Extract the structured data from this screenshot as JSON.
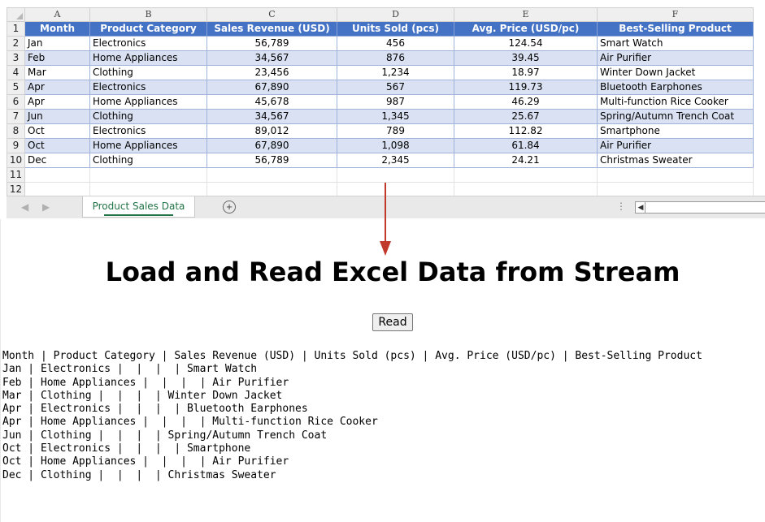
{
  "spreadsheet": {
    "column_letters": [
      "A",
      "B",
      "C",
      "D",
      "E",
      "F"
    ],
    "row_numbers": [
      "1",
      "2",
      "3",
      "4",
      "5",
      "6",
      "7",
      "8",
      "9",
      "10",
      "11",
      "12"
    ],
    "headers": [
      "Month",
      "Product Category",
      "Sales Revenue (USD)",
      "Units Sold (pcs)",
      "Avg. Price (USD/pc)",
      "Best-Selling Product"
    ],
    "rows": [
      [
        "Jan",
        "Electronics",
        "56,789",
        "456",
        "124.54",
        "Smart Watch"
      ],
      [
        "Feb",
        "Home Appliances",
        "34,567",
        "876",
        "39.45",
        "Air Purifier"
      ],
      [
        "Mar",
        "Clothing",
        "23,456",
        "1,234",
        "18.97",
        "Winter Down Jacket"
      ],
      [
        "Apr",
        "Electronics",
        "67,890",
        "567",
        "119.73",
        "Bluetooth Earphones"
      ],
      [
        "Apr",
        "Home Appliances",
        "45,678",
        "987",
        "46.29",
        "Multi-function Rice Cooker"
      ],
      [
        "Jun",
        "Clothing",
        "34,567",
        "1,345",
        "25.67",
        "Spring/Autumn Trench Coat"
      ],
      [
        "Oct",
        "Electronics",
        "89,012",
        "789",
        "112.82",
        "Smartphone"
      ],
      [
        "Oct",
        "Home Appliances",
        "67,890",
        "1,098",
        "61.84",
        "Air Purifier"
      ],
      [
        "Dec",
        "Clothing",
        "56,789",
        "2,345",
        "24.21",
        "Christmas Sweater"
      ]
    ],
    "sheet_tab": "Product Sales Data",
    "colors": {
      "header_fill": "#4472c4",
      "band_fill": "#d9e1f2",
      "tab_text": "#217346"
    }
  },
  "arrow_color": "#c0392b",
  "page": {
    "title": "Load and Read Excel Data from Stream",
    "read_button": "Read",
    "output_lines": [
      "Month | Product Category | Sales Revenue (USD) | Units Sold (pcs) | Avg. Price (USD/pc) | Best-Selling Product",
      "Jan | Electronics |  |  |  | Smart Watch",
      "Feb | Home Appliances |  |  |  | Air Purifier",
      "Mar | Clothing |  |  |  | Winter Down Jacket",
      "Apr | Electronics |  |  |  | Bluetooth Earphones",
      "Apr | Home Appliances |  |  |  | Multi-function Rice Cooker",
      "Jun | Clothing |  |  |  | Spring/Autumn Trench Coat",
      "Oct | Electronics |  |  |  | Smartphone",
      "Oct | Home Appliances |  |  |  | Air Purifier",
      "Dec | Clothing |  |  |  | Christmas Sweater"
    ]
  }
}
